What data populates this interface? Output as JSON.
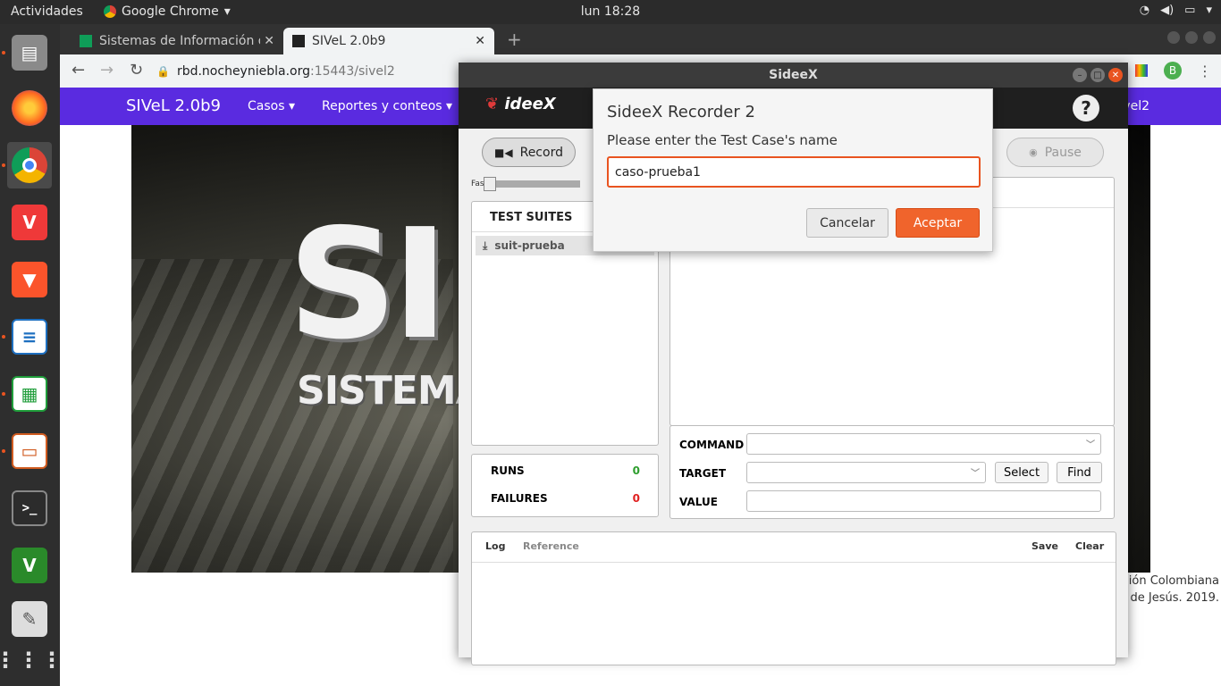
{
  "topbar": {
    "activities": "Actividades",
    "app_name": "Google Chrome",
    "clock": "lun 18:28"
  },
  "dock": {
    "items": [
      "files-icon",
      "firefox-icon",
      "chrome-icon",
      "vivaldi-icon",
      "brave-icon",
      "writer-icon",
      "calc-icon",
      "impress-icon",
      "terminal-icon",
      "vim-icon",
      "text-editor-icon",
      "app-grid-icon"
    ]
  },
  "chrome": {
    "tabs": [
      {
        "title": "Sistemas de Información d",
        "active": false
      },
      {
        "title": "SIVeL 2.0b9",
        "active": true
      }
    ],
    "url_host": "rbd.nocheyniebla.org",
    "url_rest": ":15443/sivel2",
    "profile_initial": "B"
  },
  "site": {
    "brand": "SIVeL 2.0b9",
    "nav": [
      "Casos",
      "Reportes y conteos"
    ],
    "nav_right": "vel2",
    "hero_big": "SI",
    "hero_sub": "SISTEMA DE",
    "credit_line1": "ción Colombiana",
    "credit_line2": "de Jesús. 2019."
  },
  "sideex": {
    "title": "SideeX",
    "logo": "ideeX",
    "help": "?",
    "record_label": "Record",
    "pause_label": "Pause",
    "speed_label": "Fast",
    "test_suites_label": "TEST SUITES",
    "suite_name": "suit-prueba",
    "runs_label": "RUNS",
    "runs_value": "0",
    "failures_label": "FAILURES",
    "failures_value": "0",
    "command_label": "COMMAND",
    "target_label": "TARGET",
    "value_label": "VALUE",
    "select_label": "Select",
    "find_label": "Find",
    "log_tab": "Log",
    "reference_tab": "Reference",
    "save_label": "Save",
    "clear_label": "Clear"
  },
  "dialog": {
    "title": "SideeX Recorder 2",
    "message": "Please enter the Test Case's name",
    "input_value": "caso-prueba1",
    "cancel_label": "Cancelar",
    "ok_label": "Aceptar"
  },
  "colors": {
    "accent": "#e95420",
    "site_nav": "#5a2be0",
    "runs_green": "#2e9e2e",
    "failures_red": "#e02020"
  }
}
